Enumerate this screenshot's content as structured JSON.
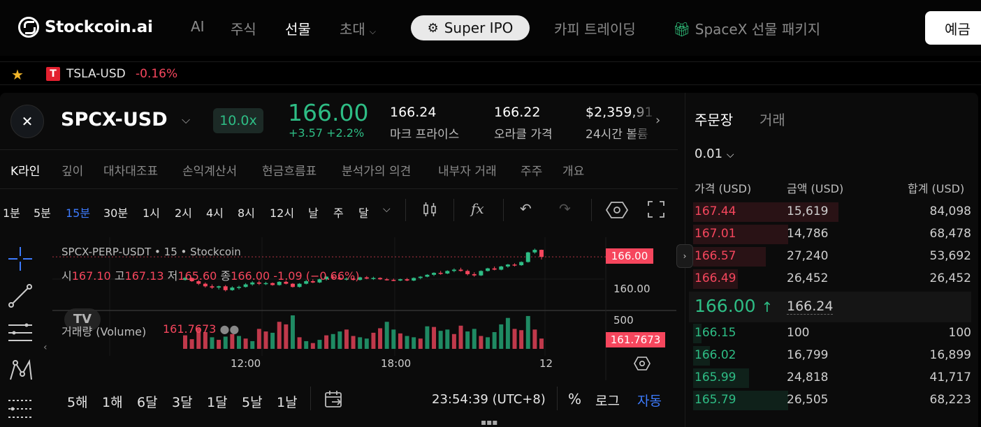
{
  "brand": {
    "name": "Stockcoin.ai"
  },
  "nav": {
    "ai": "AI",
    "stocks": "주식",
    "futures": "선물",
    "invite": "초대",
    "super_ipo": "Super IPO",
    "copy_trading": "카피 트레이딩",
    "spacex_pkg": "SpaceX 선물 패키지",
    "deposit": "예금"
  },
  "watchlist": {
    "symbol": "TSLA-USD",
    "change": "-0.16%",
    "icon_letter": "T"
  },
  "ticker": {
    "symbol": "SPCX-USD",
    "leverage": "10.0x",
    "price": "166.00",
    "change": "+3.57 +2.2%",
    "stats": [
      {
        "value": "166.24",
        "label": "마크 프라이스"
      },
      {
        "value": "166.22",
        "label": "오라클 가격"
      },
      {
        "value": "$2,359,91",
        "label": "24시간 볼륨"
      }
    ]
  },
  "tabs": [
    "K라인",
    "깊이",
    "대차대조표",
    "손익계산서",
    "현금흐름표",
    "분석가의 의견",
    "내부자 거래",
    "주주",
    "개요"
  ],
  "intervals": [
    "1분",
    "5분",
    "15분",
    "30분",
    "1시",
    "2시",
    "4시",
    "8시",
    "12시",
    "날",
    "주",
    "달"
  ],
  "chart": {
    "title": "SPCX-PERP-USDT • 15 • Stockcoin",
    "ohlc": {
      "o_label": "시",
      "o": "167.10",
      "h_label": "고",
      "h": "167.13",
      "l_label": "저",
      "l": "165.60",
      "c_label": "종",
      "c": "166.00",
      "chg": "-1.09 (−0.66%)"
    },
    "volume_label": "거래량 (Volume)",
    "volume_value": "161.7673",
    "price_tag": "166.00",
    "volume_tag": "161.7673",
    "y_ticks": [
      "160.00",
      "500"
    ],
    "x_ticks": [
      "12:00",
      "18:00",
      "12"
    ],
    "logo": "TV"
  },
  "chart_data": {
    "type": "candlestick",
    "title": "SPCX-PERP-USDT • 15 • Stockcoin",
    "x_ticks": [
      "12:00",
      "18:00",
      "12"
    ],
    "y_ticks": [
      160.0
    ],
    "last_price": 166.0,
    "candles": [
      [
        162.4,
        162.9,
        162.3,
        162.7
      ],
      [
        162.7,
        162.8,
        162.1,
        162.2
      ],
      [
        162.2,
        162.4,
        161.6,
        161.8
      ],
      [
        161.8,
        162.0,
        161.2,
        161.4
      ],
      [
        161.4,
        161.7,
        161.0,
        161.2
      ],
      [
        161.2,
        161.5,
        160.9,
        161.4
      ],
      [
        161.4,
        161.6,
        160.6,
        160.8
      ],
      [
        160.8,
        161.4,
        160.7,
        161.2
      ],
      [
        161.2,
        161.5,
        160.9,
        161.3
      ],
      [
        161.3,
        161.9,
        161.2,
        161.7
      ],
      [
        161.7,
        162.2,
        161.5,
        162.0
      ],
      [
        162.0,
        162.3,
        161.6,
        161.8
      ],
      [
        161.8,
        162.1,
        161.6,
        161.9
      ],
      [
        161.9,
        162.0,
        161.5,
        161.6
      ],
      [
        161.6,
        162.2,
        161.5,
        162.1
      ],
      [
        162.1,
        162.3,
        161.7,
        161.8
      ],
      [
        161.8,
        161.9,
        161.2,
        161.3
      ],
      [
        161.3,
        161.9,
        161.2,
        161.8
      ],
      [
        161.8,
        162.4,
        161.7,
        162.2
      ],
      [
        162.2,
        162.5,
        161.9,
        162.0
      ],
      [
        162.0,
        162.6,
        161.9,
        162.5
      ],
      [
        162.5,
        163.0,
        162.3,
        162.9
      ],
      [
        162.9,
        163.1,
        162.6,
        162.7
      ],
      [
        162.7,
        162.9,
        162.4,
        162.5
      ],
      [
        162.5,
        162.8,
        162.3,
        162.6
      ],
      [
        162.6,
        162.7,
        162.3,
        162.4
      ],
      [
        162.4,
        162.9,
        162.3,
        162.8
      ],
      [
        162.8,
        163.0,
        162.5,
        162.6
      ],
      [
        162.6,
        162.9,
        162.4,
        162.7
      ],
      [
        162.7,
        162.8,
        162.4,
        162.5
      ],
      [
        162.5,
        162.7,
        162.3,
        162.4
      ],
      [
        162.4,
        162.6,
        162.2,
        162.3
      ],
      [
        162.3,
        162.6,
        162.2,
        162.5
      ],
      [
        162.5,
        162.7,
        162.2,
        162.3
      ],
      [
        162.3,
        162.8,
        162.2,
        162.7
      ],
      [
        162.7,
        163.0,
        162.5,
        162.9
      ],
      [
        162.9,
        163.3,
        162.8,
        163.2
      ],
      [
        163.2,
        163.6,
        163.0,
        163.5
      ],
      [
        163.5,
        163.8,
        163.2,
        163.4
      ],
      [
        163.4,
        163.9,
        163.3,
        163.8
      ],
      [
        163.8,
        164.2,
        163.6,
        164.0
      ],
      [
        164.0,
        164.3,
        163.7,
        163.8
      ],
      [
        163.8,
        164.0,
        163.1,
        163.3
      ],
      [
        163.3,
        163.6,
        162.9,
        163.1
      ],
      [
        163.1,
        163.9,
        163.0,
        163.8
      ],
      [
        163.8,
        164.3,
        163.7,
        164.2
      ],
      [
        164.2,
        164.5,
        163.9,
        164.0
      ],
      [
        164.0,
        164.6,
        163.9,
        164.5
      ],
      [
        164.5,
        164.9,
        164.3,
        164.8
      ],
      [
        164.8,
        165.0,
        164.5,
        164.7
      ],
      [
        164.7,
        165.3,
        164.6,
        165.2
      ],
      [
        165.2,
        166.8,
        165.1,
        166.7
      ],
      [
        166.7,
        167.3,
        166.5,
        167.1
      ],
      [
        167.1,
        167.13,
        165.6,
        166.0
      ]
    ],
    "volume": [
      [
        210,
        0
      ],
      [
        150,
        0
      ],
      [
        320,
        0
      ],
      [
        260,
        0
      ],
      [
        180,
        1
      ],
      [
        140,
        0
      ],
      [
        190,
        1
      ],
      [
        230,
        0
      ],
      [
        200,
        1
      ],
      [
        160,
        0
      ],
      [
        120,
        1
      ],
      [
        310,
        0
      ],
      [
        270,
        0
      ],
      [
        250,
        1
      ],
      [
        420,
        0
      ],
      [
        380,
        0
      ],
      [
        520,
        1
      ],
      [
        180,
        0
      ],
      [
        120,
        1
      ],
      [
        90,
        0
      ],
      [
        140,
        1
      ],
      [
        210,
        0
      ],
      [
        230,
        1
      ],
      [
        270,
        1
      ],
      [
        300,
        0
      ],
      [
        200,
        0
      ],
      [
        180,
        1
      ],
      [
        160,
        1
      ],
      [
        250,
        0
      ],
      [
        320,
        0
      ],
      [
        420,
        1
      ],
      [
        300,
        1
      ],
      [
        240,
        0
      ],
      [
        200,
        1
      ],
      [
        180,
        1
      ],
      [
        160,
        0
      ],
      [
        350,
        1
      ],
      [
        340,
        0
      ],
      [
        280,
        1
      ],
      [
        300,
        1
      ],
      [
        230,
        0
      ],
      [
        360,
        0
      ],
      [
        270,
        1
      ],
      [
        310,
        1
      ],
      [
        200,
        0
      ],
      [
        180,
        1
      ],
      [
        260,
        1
      ],
      [
        380,
        1
      ],
      [
        480,
        1
      ],
      [
        310,
        0
      ],
      [
        290,
        0
      ],
      [
        510,
        1
      ],
      [
        300,
        0
      ],
      [
        160,
        0
      ]
    ]
  },
  "toolbar": {
    "indicators": "fx",
    "undo": "↶",
    "redo": "↷"
  },
  "ranges": [
    "5해",
    "1해",
    "6달",
    "3달",
    "1달",
    "5날",
    "1날"
  ],
  "footer": {
    "clock": "23:54:39 (UTC+8)",
    "pct": "%",
    "log": "로그",
    "auto": "자동"
  },
  "orderbook": {
    "tabs": [
      "주문장",
      "거래"
    ],
    "precision": "0.01",
    "headers": [
      "가격 (USD)",
      "금액 (USD)",
      "합계 (USD)"
    ],
    "asks": [
      {
        "price": "167.44",
        "amount": "15,619",
        "total": "84,098",
        "depth": 0.52
      },
      {
        "price": "167.01",
        "amount": "14,786",
        "total": "68,478",
        "depth": 0.34
      },
      {
        "price": "166.57",
        "amount": "27,240",
        "total": "53,692",
        "depth": 0.26
      },
      {
        "price": "166.49",
        "amount": "26,452",
        "total": "26,452",
        "depth": 0.16
      }
    ],
    "mid_price": "166.00",
    "mid_arrow": "↑",
    "mark_price": "166.24",
    "bids": [
      {
        "price": "166.15",
        "amount": "100",
        "total": "100",
        "depth": 0.03
      },
      {
        "price": "166.02",
        "amount": "16,799",
        "total": "16,899",
        "depth": 0.06
      },
      {
        "price": "165.99",
        "amount": "24,818",
        "total": "41,717",
        "depth": 0.2
      },
      {
        "price": "165.79",
        "amount": "26,505",
        "total": "68,223",
        "depth": 0.34
      }
    ]
  },
  "colors": {
    "up": "#2ebd85",
    "down": "#f6465d",
    "accent": "#3d7bfd"
  }
}
